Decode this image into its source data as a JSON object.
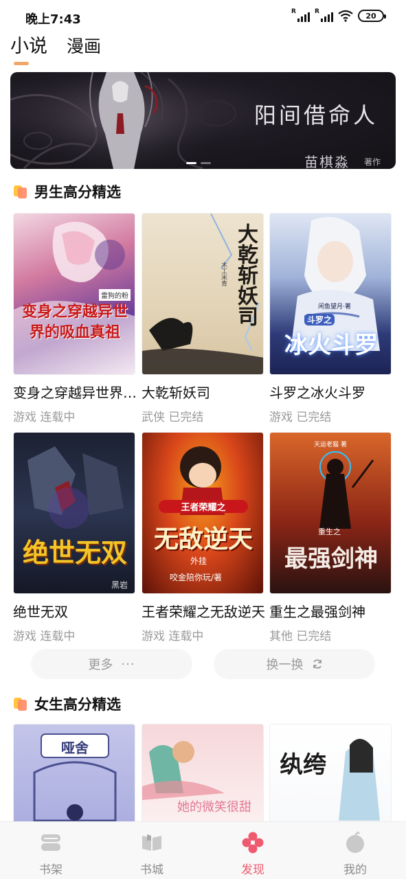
{
  "status_bar": {
    "time": "晚上7:43",
    "battery": "20"
  },
  "tabs": [
    {
      "label": "小说",
      "active": true
    },
    {
      "label": "漫画",
      "active": false
    }
  ],
  "banner": {
    "title": "阳间借命人",
    "author": "苗棋淼",
    "author_suffix": "著作"
  },
  "section_boys": {
    "title": "男生高分精选",
    "books": [
      {
        "title": "变身之穿越异世界的吸血真祖",
        "meta": "游戏 连载中",
        "cover_text": "变身之穿越异世界的吸血真祖",
        "cover_author": "雷狗的粉"
      },
      {
        "title": "大乾斩妖司",
        "meta": "武侠 已完结",
        "cover_text": "大乾斩妖司",
        "cover_author": "木工米青"
      },
      {
        "title": "斗罗之冰火斗罗",
        "meta": "游戏 已完结",
        "cover_text": "冰火斗罗",
        "cover_sub": "斗罗之",
        "cover_author": "闲鱼望月·著"
      },
      {
        "title": "绝世无双",
        "meta": "游戏 连载中",
        "cover_text": "绝世无双",
        "cover_author": "黑岩"
      },
      {
        "title": "王者荣耀之无敌逆天",
        "meta": "游戏 连载中",
        "cover_text": "无敌逆天",
        "cover_sub": "王者荣耀之",
        "cover_tag": "外挂",
        "cover_author": "咬金陪你玩/著"
      },
      {
        "title": "重生之最强剑神",
        "meta": "其他 已完结",
        "cover_text": "最强剑神",
        "cover_sub": "重生之",
        "cover_author": "天运老猫 著"
      }
    ]
  },
  "actions": {
    "more": "更多",
    "more_icon": "···",
    "refresh": "换一换"
  },
  "section_girls": {
    "title": "女生高分精选",
    "books": [
      {
        "cover_text": "哑舍"
      },
      {
        "cover_text": "她的微笑很甜"
      },
      {
        "cover_text": "纨绔"
      }
    ]
  },
  "bottom_nav": [
    {
      "label": "书架",
      "icon": "bookshelf-icon"
    },
    {
      "label": "书城",
      "icon": "bookstore-icon"
    },
    {
      "label": "发现",
      "icon": "discover-icon",
      "active": true
    },
    {
      "label": "我的",
      "icon": "profile-icon"
    }
  ],
  "colors": {
    "accent": "#ef5a6f",
    "tab_indicator": "#f0a76a",
    "meta_text": "#9a9a9a"
  }
}
